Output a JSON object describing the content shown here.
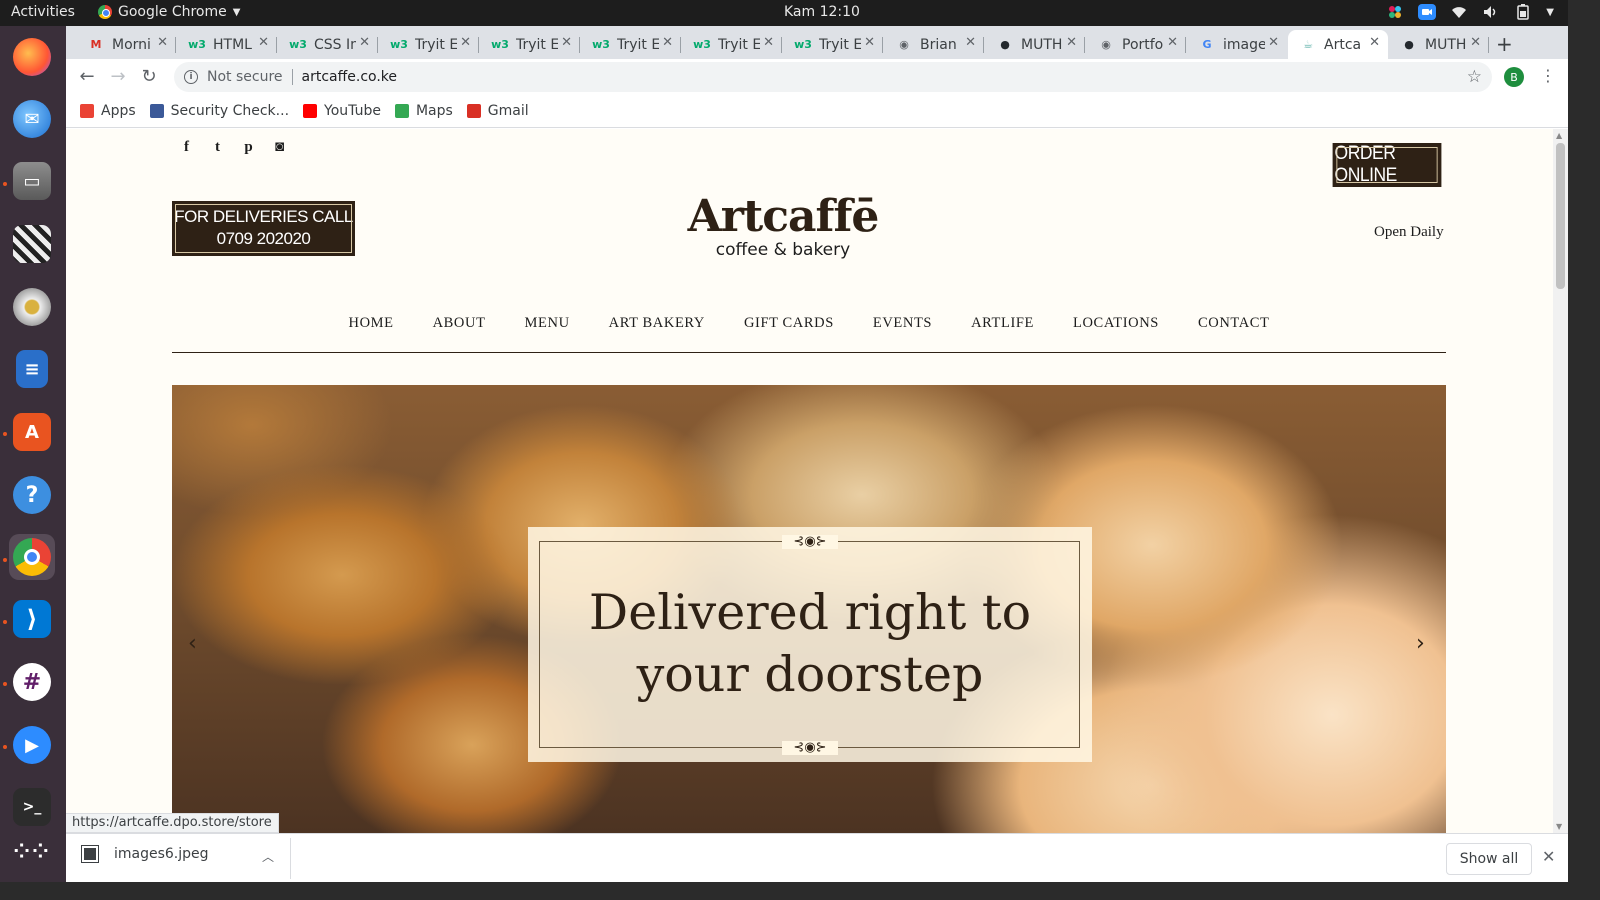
{
  "os": {
    "activities": "Activities",
    "app_name": "Google Chrome",
    "clock": "Kam 12:10"
  },
  "tabs": [
    {
      "title": "Morni",
      "icon": "gmail-icon",
      "color": "#d93025",
      "glyph": "M"
    },
    {
      "title": "HTML",
      "icon": "w3-icon",
      "color": "#04aa6d",
      "glyph": "w3"
    },
    {
      "title": "CSS In",
      "icon": "w3-icon",
      "color": "#04aa6d",
      "glyph": "w3"
    },
    {
      "title": "Tryit E",
      "icon": "w3-icon",
      "color": "#04aa6d",
      "glyph": "w3"
    },
    {
      "title": "Tryit E",
      "icon": "w3-icon",
      "color": "#04aa6d",
      "glyph": "w3"
    },
    {
      "title": "Tryit E",
      "icon": "w3-icon",
      "color": "#04aa6d",
      "glyph": "w3"
    },
    {
      "title": "Tryit E",
      "icon": "w3-icon",
      "color": "#04aa6d",
      "glyph": "w3"
    },
    {
      "title": "Tryit E",
      "icon": "w3-icon",
      "color": "#04aa6d",
      "glyph": "w3"
    },
    {
      "title": "Brian",
      "icon": "globe-icon",
      "color": "#5f6368",
      "glyph": "◉"
    },
    {
      "title": "MUTH",
      "icon": "github-icon",
      "color": "#24292e",
      "glyph": "●"
    },
    {
      "title": "Portfo",
      "icon": "globe-icon",
      "color": "#5f6368",
      "glyph": "◉"
    },
    {
      "title": "image",
      "icon": "google-icon",
      "color": "#4285f4",
      "glyph": "G"
    },
    {
      "title": "Artca",
      "icon": "artcaffe-icon",
      "color": "#6bb7b0",
      "glyph": "☕",
      "active": true
    },
    {
      "title": "MUTH",
      "icon": "github-icon",
      "color": "#24292e",
      "glyph": "●"
    }
  ],
  "omnibox": {
    "security": "Not secure",
    "url": "artcaffe.co.ke",
    "profile_initial": "B"
  },
  "bookmarks": [
    {
      "label": "Apps",
      "icon": "apps-grid-icon",
      "color": "#ea4335"
    },
    {
      "label": "Security Check...",
      "icon": "facebook-icon",
      "color": "#3b5998"
    },
    {
      "label": "YouTube",
      "icon": "youtube-icon",
      "color": "#ff0000"
    },
    {
      "label": "Maps",
      "icon": "maps-icon",
      "color": "#34a853"
    },
    {
      "label": "Gmail",
      "icon": "gmail-icon",
      "color": "#d93025"
    }
  ],
  "site": {
    "socials": [
      {
        "name": "facebook-icon",
        "glyph": "f"
      },
      {
        "name": "twitter-icon",
        "glyph": "t"
      },
      {
        "name": "pinterest-icon",
        "glyph": "p"
      },
      {
        "name": "instagram-icon",
        "glyph": "◙"
      }
    ],
    "order_online": "ORDER ONLINE",
    "delivery_line1": "FOR DELIVERIES CALL",
    "delivery_line2": "0709 202020",
    "logo_name": "Artcaffē",
    "logo_tag": "coffee & bakery",
    "open_daily": "Open Daily",
    "nav": [
      "HOME",
      "ABOUT",
      "MENU",
      "ART BAKERY",
      "GIFT CARDS",
      "EVENTS",
      "ARTLIFE",
      "LOCATIONS",
      "CONTACT"
    ],
    "hero_line1": "Delivered right to",
    "hero_line2": "your doorstep",
    "colors": {
      "brand_dark": "#2e2115",
      "page_bg": "#fffdf7"
    }
  },
  "status_bar_url": "https://artcaffe.dpo.store/store",
  "downloads": {
    "file": "images6.jpeg",
    "show_all": "Show all"
  }
}
